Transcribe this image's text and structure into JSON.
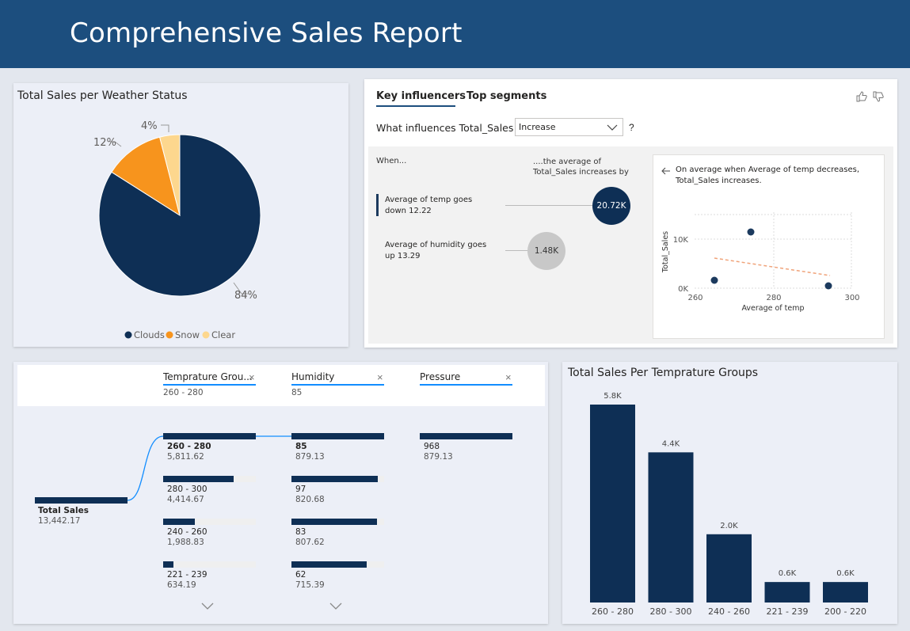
{
  "header": {
    "title": "Comprehensive Sales Report"
  },
  "pie_card": {
    "title": "Total Sales per Weather Status",
    "slices": [
      {
        "name": "Clouds",
        "label": "84%",
        "value": 84,
        "color": "#0e2f55"
      },
      {
        "name": "Snow",
        "label": "12%",
        "value": 12,
        "color": "#f7941d"
      },
      {
        "name": "Clear",
        "label": "4%",
        "value": 4,
        "color": "#fdd78e"
      }
    ],
    "legend": [
      "Clouds",
      "Snow",
      "Clear"
    ]
  },
  "influencers": {
    "tab_key": "Key influencers",
    "tab_segments": "Top segments",
    "question": "What influences Total_Sales to",
    "select_value": "Increase",
    "question_mark": "?",
    "col_when": "When...",
    "col_avg": "....the average of Total_Sales increases by",
    "items": [
      {
        "label": "Average of temp goes down 12.22",
        "value": "20.72K"
      },
      {
        "label": "Average of humidity goes up 13.29",
        "value": "1.48K"
      }
    ],
    "detail": {
      "text": "On average when Average of temp decreases, Total_Sales increases.",
      "ylabel": "Total_Sales",
      "xlabel": "Average of temp",
      "yticks": [
        "10K",
        "0K"
      ],
      "xticks": [
        "260",
        "280",
        "300"
      ]
    }
  },
  "decomp": {
    "columns": [
      {
        "title": "Temprature Grou...",
        "sub": "260 - 280"
      },
      {
        "title": "Humidity",
        "sub": "85"
      },
      {
        "title": "Pressure",
        "sub": ""
      }
    ],
    "root": {
      "label": "Total Sales",
      "value": "13,442.17"
    },
    "temp": [
      {
        "label": "260 - 280",
        "value": "5,811.62",
        "frac": 1.0
      },
      {
        "label": "280 - 300",
        "value": "4,414.67",
        "frac": 0.76
      },
      {
        "label": "240 - 260",
        "value": "1,988.83",
        "frac": 0.34
      },
      {
        "label": "221 - 239",
        "value": "634.19",
        "frac": 0.11
      }
    ],
    "humidity": [
      {
        "label": "85",
        "value": "879.13",
        "frac": 1.0
      },
      {
        "label": "97",
        "value": "820.68",
        "frac": 0.93
      },
      {
        "label": "83",
        "value": "807.62",
        "frac": 0.92
      },
      {
        "label": "62",
        "value": "715.39",
        "frac": 0.81
      }
    ],
    "pressure": [
      {
        "label": "968",
        "value": "879.13",
        "frac": 1.0
      }
    ]
  },
  "chart_data": {
    "type": "bar",
    "title": "Total Sales Per Temprature Groups",
    "categories": [
      "260 - 280",
      "280 - 300",
      "240 - 260",
      "221 - 239",
      "200 - 220"
    ],
    "values": [
      5.8,
      4.4,
      2.0,
      0.6,
      0.6
    ],
    "value_labels": [
      "5.8K",
      "4.4K",
      "2.0K",
      "0.6K",
      "0.6K"
    ],
    "ylim": [
      0,
      5.8
    ],
    "xlabel": "",
    "ylabel": "",
    "color": "#0e2f55"
  }
}
